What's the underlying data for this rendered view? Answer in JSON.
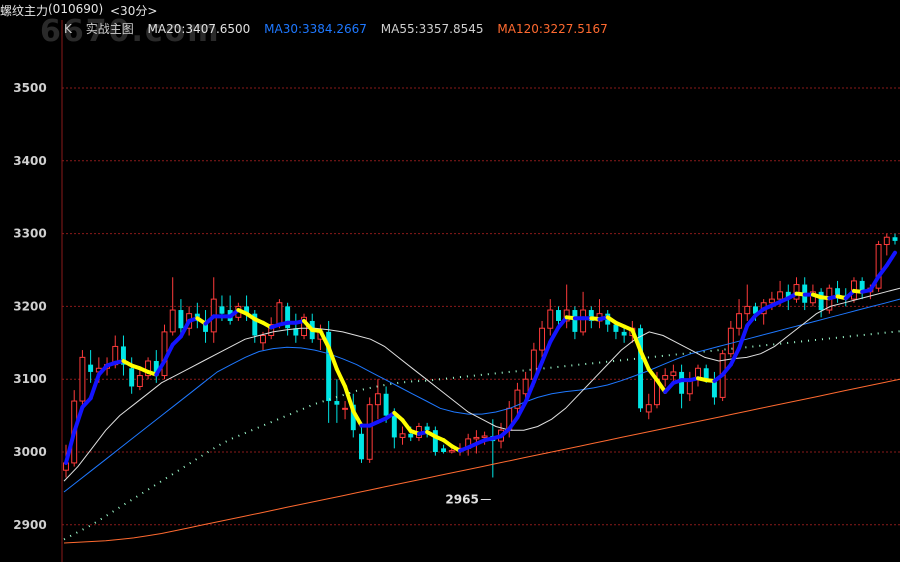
{
  "header": {
    "instrument": "螺纹主力",
    "code": "(010690)",
    "period": "<30分>",
    "watermark": "6670.com"
  },
  "legend": {
    "k_label": "K",
    "template": "实战主图",
    "ma20": "MA20:3407.6500",
    "ma30": "MA30:3384.2667",
    "ma55": "MA55:3357.8545",
    "ma120": "MA120:3227.5167"
  },
  "colors": {
    "up": "#ff3b3b",
    "down": "#00e5e5",
    "ma20": "#e0e0e0",
    "ma30": "#1e78ff",
    "ma55": "#b8b8b8",
    "ma120": "#ff6a30",
    "trend_up": "#1414ff",
    "trend_down": "#ffff00",
    "dotted": "#a0ffd0",
    "grid": "#8a1a1a",
    "axis_text": "#d0d0d0"
  },
  "chart_data": {
    "type": "candlestick",
    "ylim": [
      2880,
      3560
    ],
    "yticks": [
      2900,
      3000,
      3100,
      3200,
      3300,
      3400,
      3500
    ],
    "low_marker": {
      "label": "2965",
      "value": 2965,
      "index": 52
    },
    "candles": [
      [
        2975,
        3010,
        2965,
        2985
      ],
      [
        2985,
        3085,
        2980,
        3070
      ],
      [
        3070,
        3140,
        3060,
        3130
      ],
      [
        3120,
        3140,
        3095,
        3110
      ],
      [
        3110,
        3130,
        3095,
        3115
      ],
      [
        3115,
        3130,
        3105,
        3120
      ],
      [
        3120,
        3160,
        3115,
        3145
      ],
      [
        3145,
        3160,
        3105,
        3120
      ],
      [
        3115,
        3130,
        3080,
        3090
      ],
      [
        3090,
        3115,
        3085,
        3105
      ],
      [
        3105,
        3130,
        3100,
        3125
      ],
      [
        3125,
        3140,
        3095,
        3105
      ],
      [
        3105,
        3175,
        3100,
        3165
      ],
      [
        3165,
        3240,
        3160,
        3195
      ],
      [
        3195,
        3210,
        3160,
        3170
      ],
      [
        3170,
        3200,
        3160,
        3190
      ],
      [
        3190,
        3205,
        3170,
        3180
      ],
      [
        3180,
        3195,
        3150,
        3165
      ],
      [
        3165,
        3240,
        3150,
        3210
      ],
      [
        3200,
        3215,
        3180,
        3190
      ],
      [
        3195,
        3215,
        3175,
        3180
      ],
      [
        3185,
        3205,
        3180,
        3200
      ],
      [
        3200,
        3215,
        3180,
        3190
      ],
      [
        3190,
        3195,
        3150,
        3160
      ],
      [
        3150,
        3165,
        3140,
        3160
      ],
      [
        3160,
        3185,
        3155,
        3175
      ],
      [
        3175,
        3210,
        3170,
        3205
      ],
      [
        3200,
        3205,
        3160,
        3170
      ],
      [
        3170,
        3190,
        3150,
        3160
      ],
      [
        3160,
        3190,
        3155,
        3185
      ],
      [
        3180,
        3190,
        3150,
        3155
      ],
      [
        3155,
        3175,
        3140,
        3165
      ],
      [
        3165,
        3180,
        3040,
        3070
      ],
      [
        3070,
        3100,
        3040,
        3065
      ],
      [
        3060,
        3070,
        3045,
        3060
      ],
      [
        3065,
        3080,
        3020,
        3030
      ],
      [
        3025,
        3035,
        2985,
        2990
      ],
      [
        2990,
        3075,
        2985,
        3065
      ],
      [
        3065,
        3100,
        3045,
        3080
      ],
      [
        3080,
        3090,
        3040,
        3050
      ],
      [
        3050,
        3060,
        3005,
        3020
      ],
      [
        3020,
        3035,
        3010,
        3025
      ],
      [
        3025,
        3035,
        3015,
        3020
      ],
      [
        3020,
        3040,
        3015,
        3035
      ],
      [
        3035,
        3040,
        3020,
        3030
      ],
      [
        3030,
        3035,
        2995,
        3000
      ],
      [
        3005,
        3010,
        2998,
        3000
      ],
      [
        3000,
        3010,
        2998,
        3002
      ],
      [
        3002,
        3012,
        2995,
        3005
      ],
      [
        3005,
        3025,
        2995,
        3018
      ],
      [
        3018,
        3030,
        2998,
        3020
      ],
      [
        3020,
        3028,
        3010,
        3022
      ],
      [
        3022,
        3045,
        2965,
        3015
      ],
      [
        3015,
        3040,
        3005,
        3030
      ],
      [
        3030,
        3070,
        3020,
        3060
      ],
      [
        3060,
        3095,
        3050,
        3085
      ],
      [
        3080,
        3110,
        3070,
        3100
      ],
      [
        3100,
        3150,
        3090,
        3140
      ],
      [
        3140,
        3180,
        3130,
        3170
      ],
      [
        3170,
        3210,
        3160,
        3195
      ],
      [
        3195,
        3200,
        3170,
        3180
      ],
      [
        3180,
        3230,
        3170,
        3195
      ],
      [
        3195,
        3200,
        3155,
        3165
      ],
      [
        3165,
        3220,
        3160,
        3195
      ],
      [
        3195,
        3200,
        3170,
        3180
      ],
      [
        3180,
        3210,
        3170,
        3190
      ],
      [
        3190,
        3195,
        3165,
        3175
      ],
      [
        3175,
        3180,
        3155,
        3165
      ],
      [
        3165,
        3170,
        3150,
        3160
      ],
      [
        3160,
        3180,
        3150,
        3170
      ],
      [
        3170,
        3175,
        3055,
        3060
      ],
      [
        3055,
        3080,
        3045,
        3065
      ],
      [
        3065,
        3110,
        3060,
        3100
      ],
      [
        3100,
        3115,
        3090,
        3105
      ],
      [
        3105,
        3120,
        3095,
        3110
      ],
      [
        3110,
        3120,
        3060,
        3080
      ],
      [
        3080,
        3110,
        3070,
        3100
      ],
      [
        3100,
        3120,
        3090,
        3115
      ],
      [
        3115,
        3120,
        3095,
        3100
      ],
      [
        3100,
        3110,
        3065,
        3075
      ],
      [
        3075,
        3140,
        3070,
        3135
      ],
      [
        3135,
        3180,
        3130,
        3170
      ],
      [
        3170,
        3210,
        3160,
        3190
      ],
      [
        3190,
        3230,
        3180,
        3200
      ],
      [
        3200,
        3205,
        3180,
        3190
      ],
      [
        3190,
        3210,
        3175,
        3205
      ],
      [
        3205,
        3220,
        3195,
        3210
      ],
      [
        3210,
        3235,
        3200,
        3220
      ],
      [
        3220,
        3230,
        3195,
        3210
      ],
      [
        3210,
        3240,
        3205,
        3230
      ],
      [
        3230,
        3240,
        3195,
        3205
      ],
      [
        3205,
        3230,
        3200,
        3220
      ],
      [
        3220,
        3225,
        3185,
        3195
      ],
      [
        3195,
        3230,
        3190,
        3225
      ],
      [
        3225,
        3235,
        3205,
        3215
      ],
      [
        3215,
        3225,
        3200,
        3210
      ],
      [
        3210,
        3240,
        3205,
        3235
      ],
      [
        3235,
        3240,
        3210,
        3220
      ],
      [
        3220,
        3230,
        3210,
        3225
      ],
      [
        3225,
        3290,
        3220,
        3285
      ],
      [
        3285,
        3300,
        3270,
        3295
      ],
      [
        3295,
        3300,
        3285,
        3290
      ]
    ],
    "ma20": [
      2960,
      2980,
      3005,
      3030,
      3050,
      3065,
      3080,
      3095,
      3105,
      3115,
      3125,
      3135,
      3145,
      3155,
      3160,
      3165,
      3168,
      3170,
      3170,
      3168,
      3165,
      3160,
      3155,
      3145,
      3130,
      3115,
      3100,
      3085,
      3070,
      3055,
      3045,
      3035,
      3030,
      3030,
      3035,
      3045,
      3060,
      3080,
      3100,
      3120,
      3140,
      3155,
      3165,
      3160,
      3150,
      3140,
      3130,
      3125,
      3128,
      3130,
      3135,
      3145,
      3160,
      3175,
      3190,
      3200,
      3205,
      3210,
      3215,
      3220,
      3225
    ],
    "ma30": [
      2945,
      2960,
      2975,
      2990,
      3005,
      3020,
      3035,
      3050,
      3065,
      3080,
      3095,
      3110,
      3120,
      3130,
      3138,
      3142,
      3144,
      3143,
      3140,
      3135,
      3128,
      3120,
      3110,
      3100,
      3090,
      3080,
      3070,
      3060,
      3055,
      3052,
      3052,
      3055,
      3060,
      3068,
      3075,
      3080,
      3083,
      3085,
      3088,
      3092,
      3098,
      3105,
      3112,
      3120,
      3128,
      3135,
      3140,
      3145,
      3150,
      3155,
      3160,
      3165,
      3170,
      3175,
      3180,
      3185,
      3190,
      3195,
      3200,
      3205,
      3210
    ],
    "ma55": [
      2880,
      2890,
      2900,
      2912,
      2924,
      2936,
      2948,
      2960,
      2972,
      2984,
      2996,
      3008,
      3018,
      3026,
      3034,
      3042,
      3050,
      3058,
      3066,
      3072,
      3078,
      3084,
      3088,
      3092,
      3095,
      3097,
      3098,
      3100,
      3102,
      3104,
      3106,
      3108,
      3110,
      3112,
      3114,
      3116,
      3118,
      3120,
      3122,
      3124,
      3126,
      3128,
      3130,
      3132,
      3134,
      3136,
      3138,
      3140,
      3142,
      3144,
      3146,
      3148,
      3150,
      3152,
      3154,
      3156,
      3158,
      3160,
      3162,
      3164,
      3166
    ],
    "ma120": [
      2875,
      2876,
      2877,
      2878,
      2880,
      2882,
      2885,
      2888,
      2892,
      2896,
      2900,
      2904,
      2908,
      2912,
      2916,
      2920,
      2924,
      2928,
      2932,
      2936,
      2940,
      2944,
      2948,
      2952,
      2956,
      2960,
      2964,
      2968,
      2972,
      2976,
      2980,
      2984,
      2988,
      2992,
      2996,
      3000,
      3004,
      3008,
      3012,
      3016,
      3020,
      3024,
      3028,
      3032,
      3036,
      3040,
      3044,
      3048,
      3052,
      3056,
      3060,
      3064,
      3068,
      3072,
      3076,
      3080,
      3084,
      3088,
      3092,
      3096,
      3100
    ]
  }
}
